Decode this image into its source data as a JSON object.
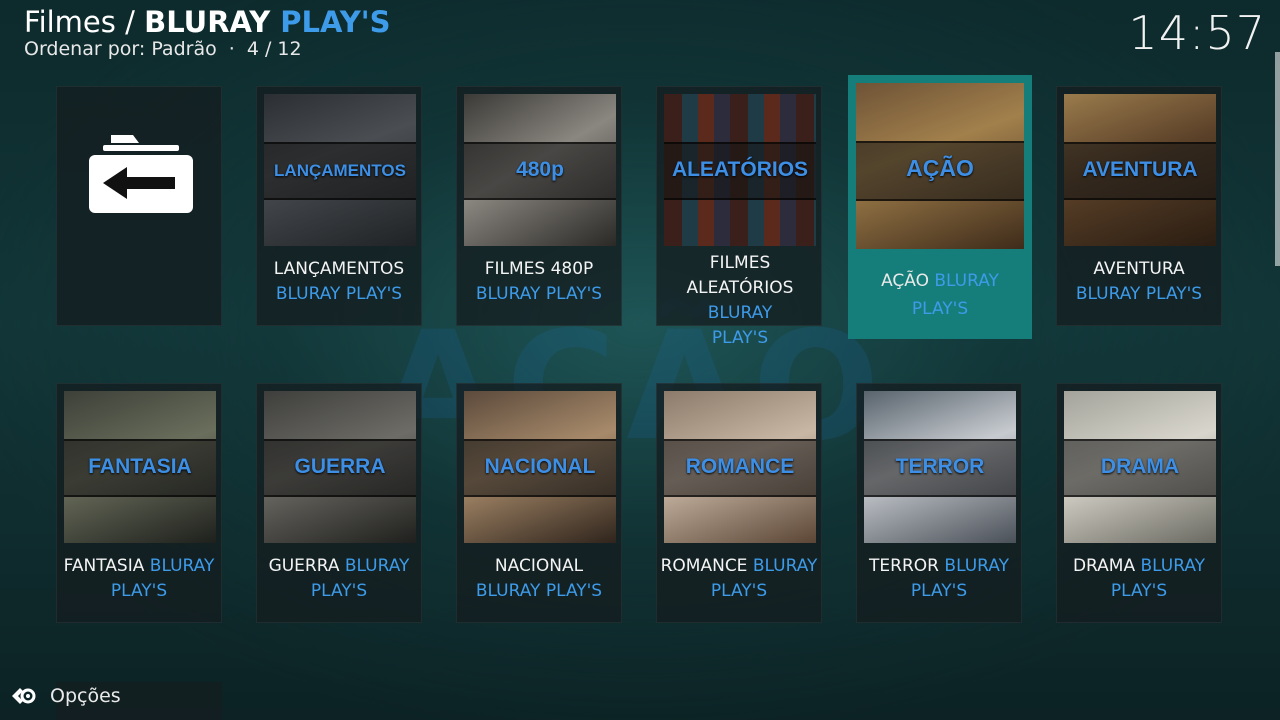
{
  "header": {
    "path": "Filmes / ",
    "title_part1": "BLURAY ",
    "title_part2": "PLAY'S",
    "sort_label": "Ordenar por: Padrão",
    "separator": "·",
    "position": "4 / 12"
  },
  "clock": "14:57",
  "background_word": "AÇÃO",
  "tiles": [
    {
      "genre": "LANÇAMENTOS",
      "label_white": "LANÇAMENTOS",
      "label_blue": "BLURAY PLAY'S"
    },
    {
      "genre": "480p",
      "label_white": "FILMES 480P",
      "label_blue": "BLURAY PLAY'S"
    },
    {
      "genre": "ALEATÓRIOS",
      "label_white": "FILMES ALEATÓRIOS",
      "label_blue": "BLURAY PLAY'S"
    },
    {
      "genre": "AÇÃO",
      "label_white": "AÇÃO ",
      "label_blue": "BLURAY PLAY'S"
    },
    {
      "genre": "AVENTURA",
      "label_white": "AVENTURA",
      "label_blue": "BLURAY PLAY'S"
    },
    {
      "genre": "FANTASIA",
      "label_white": "FANTASIA ",
      "label_blue": "BLURAY PLAY'S"
    },
    {
      "genre": "GUERRA",
      "label_white": "GUERRA ",
      "label_blue": "BLURAY PLAY'S"
    },
    {
      "genre": "NACIONAL",
      "label_white": "NACIONAL",
      "label_blue": "BLURAY PLAY'S"
    },
    {
      "genre": "ROMANCE",
      "label_white": "ROMANCE ",
      "label_blue": "BLURAY PLAY'S"
    },
    {
      "genre": "TERROR",
      "label_white": "TERROR ",
      "label_blue": "BLURAY PLAY'S"
    },
    {
      "genre": "DRAMA",
      "label_white": "DRAMA ",
      "label_blue": "BLURAY PLAY'S"
    }
  ],
  "footer": {
    "options_label": "Opções",
    "icon": "options-gear-icon"
  },
  "colors": {
    "accent_blue": "#3d9be9",
    "focus_teal": "#157e7a"
  }
}
